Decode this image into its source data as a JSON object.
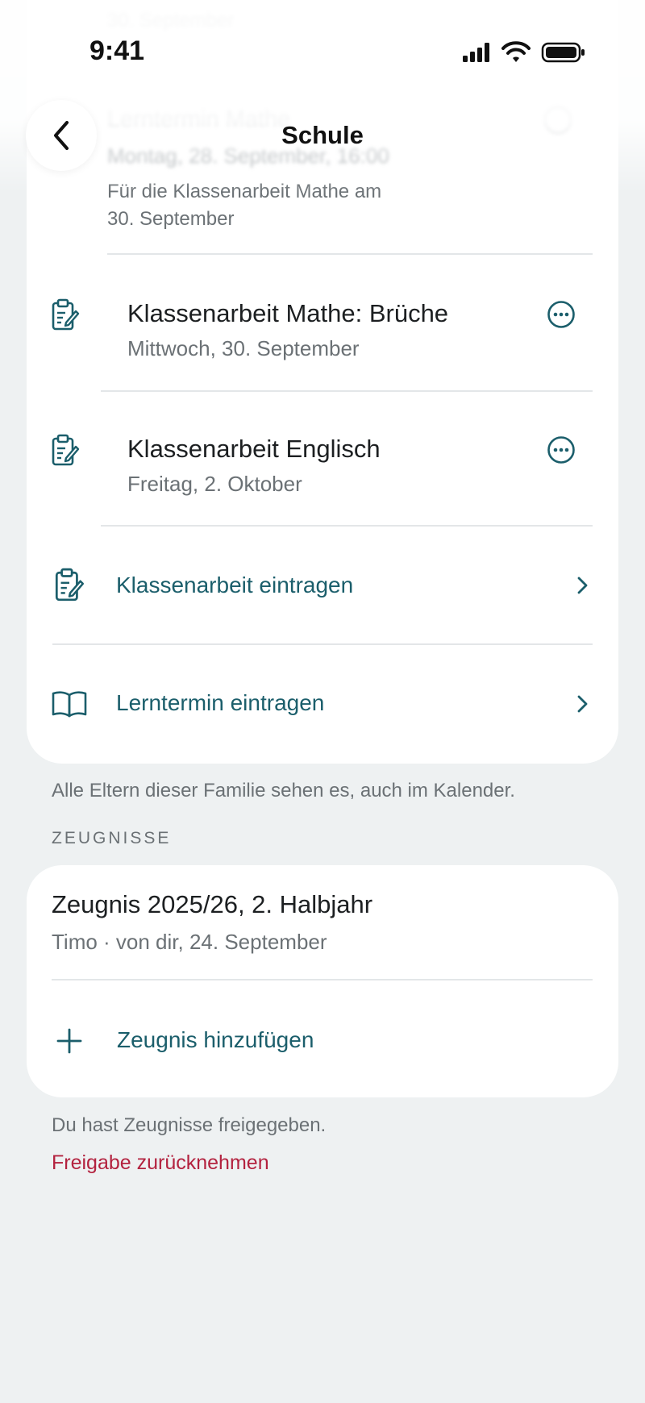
{
  "status": {
    "time": "9:41"
  },
  "nav": {
    "title": "Schule",
    "back_icon": "chevron-left-icon"
  },
  "school_list": {
    "faded_top_sub": "30. September",
    "faded_item": {
      "title": "Lerntermin Mathe",
      "date": "Montag, 28. September, 16:00",
      "note_line1": "Für die Klassenarbeit Mathe am",
      "note_line2": "30. September"
    },
    "items": [
      {
        "title": "Klassenarbeit Mathe: Brüche",
        "date": "Mittwoch, 30. September",
        "icon": "clipboard-edit-icon"
      },
      {
        "title": "Klassenarbeit Englisch",
        "date": "Freitag, 2. Oktober",
        "icon": "clipboard-edit-icon"
      }
    ],
    "actions": [
      {
        "label": "Klassenarbeit eintragen",
        "icon": "clipboard-edit-icon"
      },
      {
        "label": "Lerntermin eintragen",
        "icon": "book-open-icon"
      }
    ],
    "footnote": "Alle Eltern dieser Familie sehen es, auch im Kalender."
  },
  "zeugnisse": {
    "section_title": "ZEUGNISSE",
    "item": {
      "title": "Zeugnis 2025/26, 2. Halbjahr",
      "meta": "Timo · von dir, 24. September"
    },
    "add_label": "Zeugnis hinzufügen",
    "shared_note": "Du hast Zeugnisse freigegeben.",
    "revoke_link": "Freigabe zurücknehmen"
  },
  "colors": {
    "accent": "#1b5e6b",
    "danger": "#b3223f",
    "background": "#eef1f2"
  }
}
